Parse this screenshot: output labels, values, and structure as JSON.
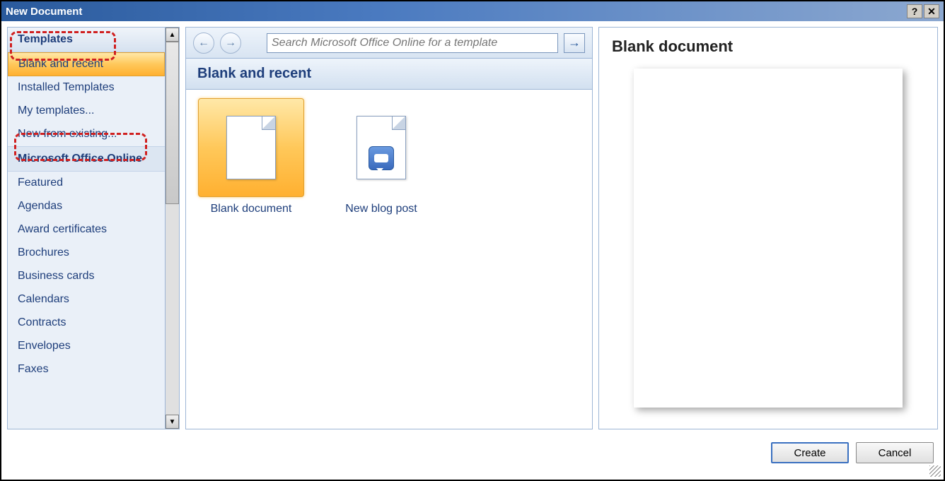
{
  "titlebar": {
    "title": "New Document"
  },
  "sidebar": {
    "header": "Templates",
    "items": [
      {
        "label": "Blank and recent",
        "selected": true
      },
      {
        "label": "Installed Templates"
      },
      {
        "label": "My templates..."
      },
      {
        "label": "New from existing..."
      }
    ],
    "section_header": "Microsoft Office Online",
    "online_items": [
      {
        "label": "Featured"
      },
      {
        "label": "Agendas"
      },
      {
        "label": "Award certificates"
      },
      {
        "label": "Brochures"
      },
      {
        "label": "Business cards"
      },
      {
        "label": "Calendars"
      },
      {
        "label": "Contracts"
      },
      {
        "label": "Envelopes"
      },
      {
        "label": "Faxes"
      }
    ]
  },
  "toolbar": {
    "search_placeholder": "Search Microsoft Office Online for a template"
  },
  "main": {
    "section_title": "Blank and recent",
    "items": [
      {
        "label": "Blank document",
        "type": "blank",
        "selected": true
      },
      {
        "label": "New blog post",
        "type": "blog"
      }
    ]
  },
  "preview": {
    "title": "Blank document"
  },
  "footer": {
    "create": "Create",
    "cancel": "Cancel"
  }
}
